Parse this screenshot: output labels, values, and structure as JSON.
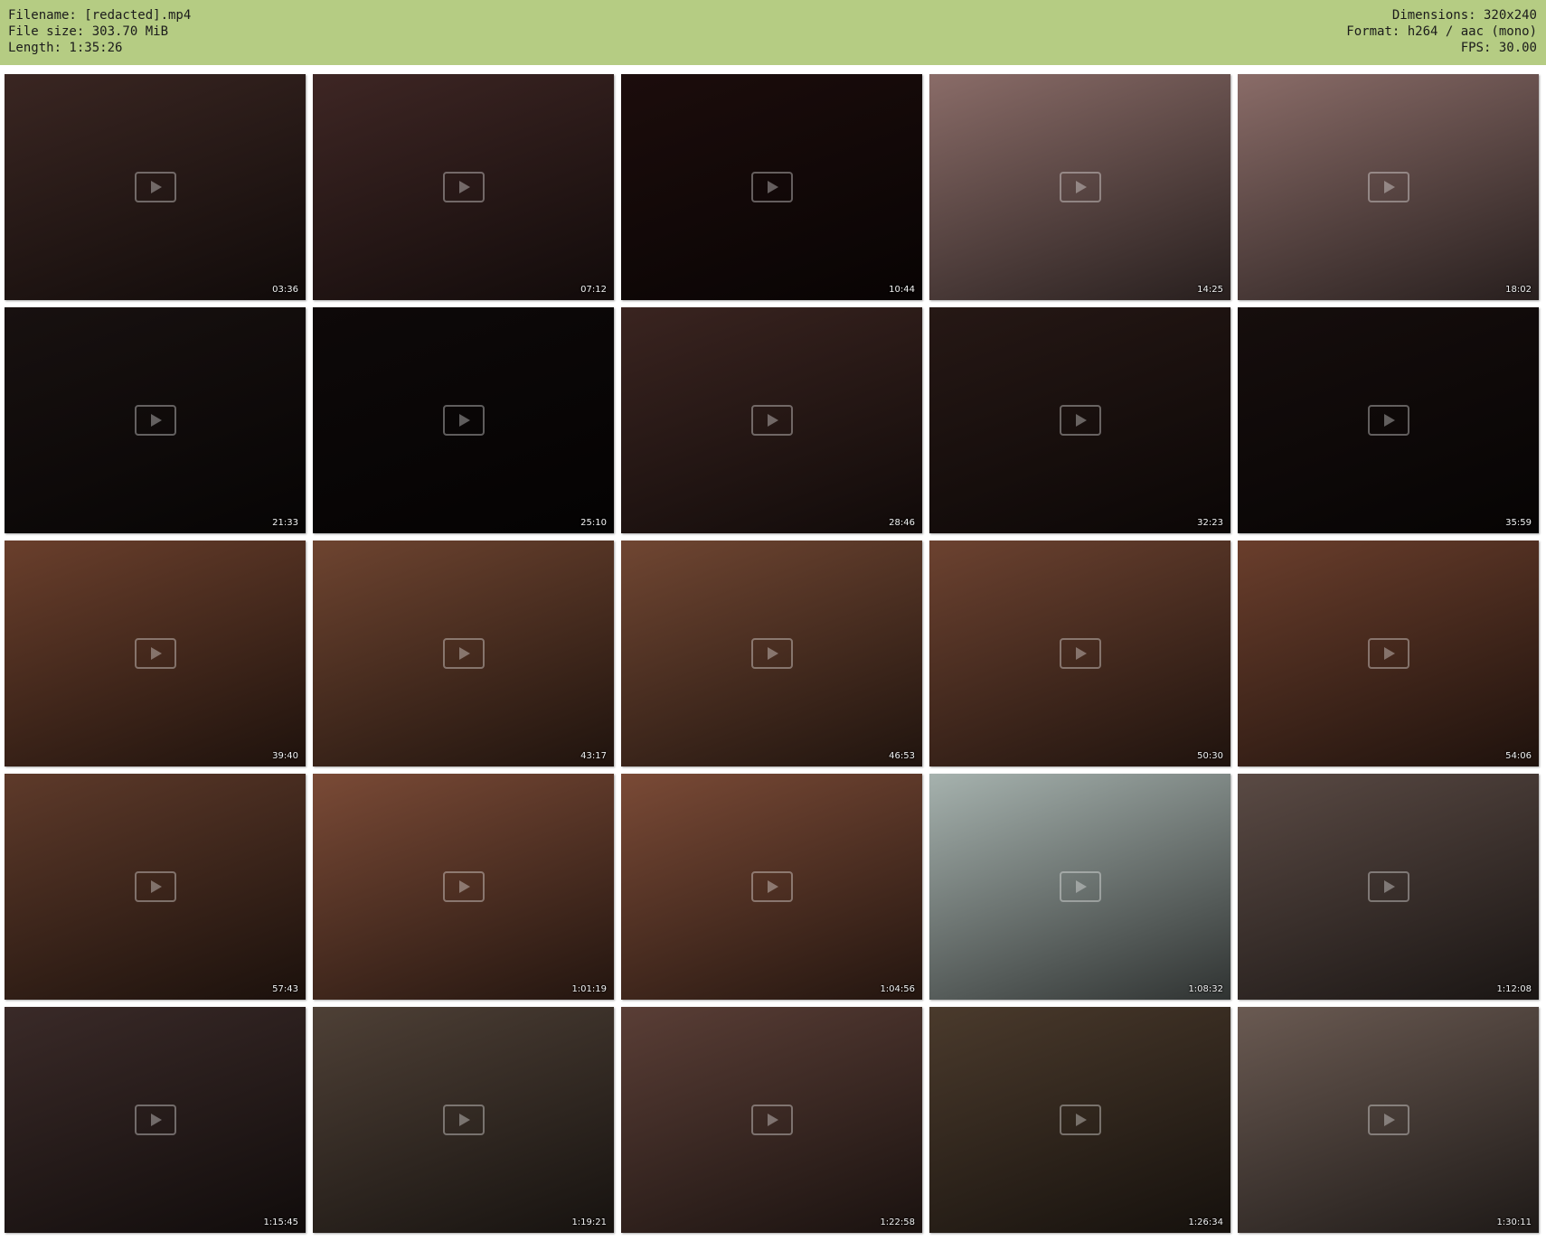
{
  "header": {
    "filename": "Filename: [redacted].mp4",
    "filesize": "File size: 303.70 MiB",
    "length": "Length: 1:35:26",
    "dimensions": "Dimensions: 320x240",
    "format": "Format: h264 / aac (mono)",
    "fps": "FPS: 30.00"
  },
  "thumbnails": [
    {
      "time": "03:36",
      "tone": "#3a2622"
    },
    {
      "time": "07:12",
      "tone": "#3e2624"
    },
    {
      "time": "10:44",
      "tone": "#1c0d0c"
    },
    {
      "time": "14:25",
      "tone": "#8a6c68"
    },
    {
      "time": "18:02",
      "tone": "#8a6c68"
    },
    {
      "time": "21:33",
      "tone": "#181110"
    },
    {
      "time": "25:10",
      "tone": "#0e0909"
    },
    {
      "time": "28:46",
      "tone": "#3a2420"
    },
    {
      "time": "32:23",
      "tone": "#261815"
    },
    {
      "time": "35:59",
      "tone": "#160e0d"
    },
    {
      "time": "39:40",
      "tone": "#6a3f2c"
    },
    {
      "time": "43:17",
      "tone": "#6e4430"
    },
    {
      "time": "46:53",
      "tone": "#704632"
    },
    {
      "time": "50:30",
      "tone": "#6c4230"
    },
    {
      "time": "54:06",
      "tone": "#6a3e2c"
    },
    {
      "time": "57:43",
      "tone": "#5e3a2a"
    },
    {
      "time": "1:01:19",
      "tone": "#7a4a36"
    },
    {
      "time": "1:04:56",
      "tone": "#7a4a36"
    },
    {
      "time": "1:08:32",
      "tone": "#a6b2ae"
    },
    {
      "time": "1:12:08",
      "tone": "#5a4a44"
    },
    {
      "time": "1:15:45",
      "tone": "#3a2a28"
    },
    {
      "time": "1:19:21",
      "tone": "#4e4036"
    },
    {
      "time": "1:22:58",
      "tone": "#5a3e36"
    },
    {
      "time": "1:26:34",
      "tone": "#4a3a2c"
    },
    {
      "time": "1:30:11",
      "tone": "#6a5a52"
    }
  ]
}
